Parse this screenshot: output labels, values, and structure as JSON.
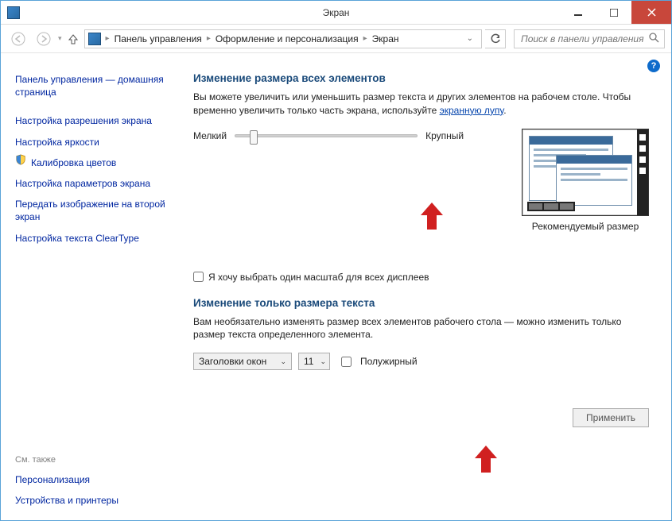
{
  "window": {
    "title": "Экран"
  },
  "breadcrumb": {
    "items": [
      "Панель управления",
      "Оформление и персонализация",
      "Экран"
    ]
  },
  "search": {
    "placeholder": "Поиск в панели управления"
  },
  "sidebar": {
    "items": [
      "Панель управления — домашняя страница",
      "Настройка разрешения экрана",
      "Настройка яркости",
      "Калибровка цветов",
      "Настройка параметров экрана",
      "Передать изображение на второй экран",
      "Настройка текста ClearType"
    ],
    "see_also_header": "См. также",
    "see_also": [
      "Персонализация",
      "Устройства и принтеры"
    ]
  },
  "main": {
    "section1_title": "Изменение размера всех элементов",
    "section1_desc_pre": "Вы можете увеличить или уменьшить размер текста и других элементов на рабочем столе. Чтобы временно увеличить только часть экрана, используйте ",
    "section1_link": "экранную лупу",
    "section1_desc_post": ".",
    "slider_min": "Мелкий",
    "slider_max": "Крупный",
    "preview_caption": "Рекомендуемый размер",
    "checkbox_label": "Я хочу выбрать один масштаб для всех дисплеев",
    "section2_title": "Изменение только размера текста",
    "section2_desc": "Вам необязательно изменять размер всех элементов рабочего стола — можно изменить только размер текста определенного элемента.",
    "element_select": "Заголовки окон",
    "size_select": "11",
    "bold_label": "Полужирный",
    "apply": "Применить"
  }
}
